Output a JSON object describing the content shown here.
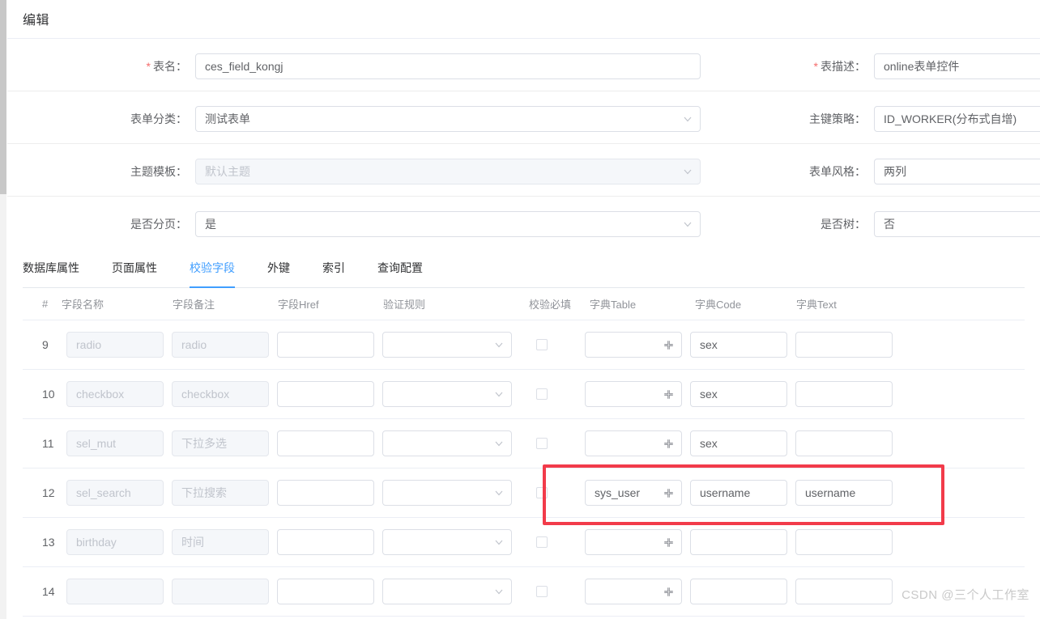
{
  "dialog": {
    "title": "编辑"
  },
  "form": {
    "left": [
      {
        "label": "表名",
        "required": true,
        "value": "ces_field_kongj",
        "type": "input",
        "disabled": false
      },
      {
        "label": "表单分类",
        "required": false,
        "value": "测试表单",
        "type": "select",
        "disabled": false
      },
      {
        "label": "主题模板",
        "required": false,
        "value": "默认主题",
        "type": "select",
        "disabled": true
      },
      {
        "label": "是否分页",
        "required": false,
        "value": "是",
        "type": "select",
        "disabled": false
      }
    ],
    "right": [
      {
        "label": "表描述",
        "required": true,
        "value": "online表单控件",
        "type": "input",
        "disabled": false
      },
      {
        "label": "主键策略",
        "required": false,
        "value": "ID_WORKER(分布式自增)",
        "type": "select",
        "disabled": false
      },
      {
        "label": "表单风格",
        "required": false,
        "value": "两列",
        "type": "select",
        "disabled": false
      },
      {
        "label": "是否树",
        "required": false,
        "value": "否",
        "type": "select",
        "disabled": false
      }
    ]
  },
  "tabs": [
    {
      "label": "数据库属性",
      "active": false
    },
    {
      "label": "页面属性",
      "active": false
    },
    {
      "label": "校验字段",
      "active": true
    },
    {
      "label": "外键",
      "active": false
    },
    {
      "label": "索引",
      "active": false
    },
    {
      "label": "查询配置",
      "active": false
    }
  ],
  "table": {
    "columns": [
      {
        "key": "num",
        "label": "#"
      },
      {
        "key": "name",
        "label": "字段名称"
      },
      {
        "key": "remark",
        "label": "字段备注"
      },
      {
        "key": "href",
        "label": "字段Href"
      },
      {
        "key": "rule",
        "label": "验证规则"
      },
      {
        "key": "required",
        "label": "校验必填"
      },
      {
        "key": "dictTable",
        "label": "字典Table"
      },
      {
        "key": "dictCode",
        "label": "字典Code"
      },
      {
        "key": "dictText",
        "label": "字典Text"
      }
    ],
    "rows": [
      {
        "num": "9",
        "name": "radio",
        "remark": "radio",
        "href": "",
        "rule": "",
        "required": false,
        "dictTable": "",
        "dictCode": "sex",
        "dictText": ""
      },
      {
        "num": "10",
        "name": "checkbox",
        "remark": "checkbox",
        "href": "",
        "rule": "",
        "required": false,
        "dictTable": "",
        "dictCode": "sex",
        "dictText": ""
      },
      {
        "num": "11",
        "name": "sel_mut",
        "remark": "下拉多选",
        "href": "",
        "rule": "",
        "required": false,
        "dictTable": "",
        "dictCode": "sex",
        "dictText": ""
      },
      {
        "num": "12",
        "name": "sel_search",
        "remark": "下拉搜索",
        "href": "",
        "rule": "",
        "required": false,
        "dictTable": "sys_user",
        "dictCode": "username",
        "dictText": "username"
      },
      {
        "num": "13",
        "name": "birthday",
        "remark": "时间",
        "href": "",
        "rule": "",
        "required": false,
        "dictTable": "",
        "dictCode": "",
        "dictText": ""
      },
      {
        "num": "14",
        "name": "",
        "remark": "",
        "href": "",
        "rule": "",
        "required": false,
        "dictTable": "",
        "dictCode": "",
        "dictText": ""
      }
    ],
    "highlighted_row_num": "12"
  },
  "icons": {
    "dict_table_suffix": "expand-shrink-icon",
    "select_caret": "chevron-down-icon"
  },
  "colors": {
    "accent": "#409eff",
    "required_star": "#f56c6c",
    "highlight_box": "#f23b4a",
    "border": "#dcdfe6",
    "text": "#606266",
    "muted_text": "#c0c4cc"
  },
  "watermark": {
    "text": "CSDN @三个人工作室"
  }
}
